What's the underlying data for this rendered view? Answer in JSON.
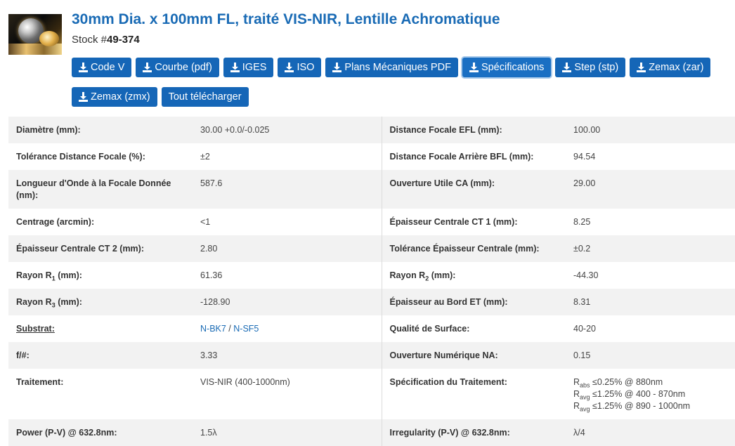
{
  "product": {
    "title": "30mm Dia. x 100mm FL, traité VIS-NIR, Lentille Achromatique",
    "stock_prefix": "Stock #",
    "stock_number": "49-374"
  },
  "icons": {
    "download": "download-icon",
    "thumbnail": "achromatic-lens-image"
  },
  "colors": {
    "primary": "#1566b7",
    "title": "#1a6bb5",
    "row_alt": "#f2f2f2"
  },
  "buttons_row1": [
    "Code V",
    "Courbe (pdf)",
    "IGES",
    "ISO",
    "Plans Mécaniques PDF",
    "Spécifications",
    "Step (stp)",
    "Zemax (zar)"
  ],
  "buttons_row2": [
    "Zemax (zmx)",
    "Tout télécharger"
  ],
  "specs": {
    "diametre": {
      "label": "Diamètre (mm):",
      "value": "30.00 +0.0/-0.025"
    },
    "efl": {
      "label": "Distance Focale EFL (mm):",
      "value": "100.00"
    },
    "tol_focale": {
      "label": "Tolérance Distance Focale (%):",
      "value": "±2"
    },
    "bfl": {
      "label": "Distance Focale Arrière BFL (mm):",
      "value": "94.54"
    },
    "longueur_onde": {
      "label": "Longueur d'Onde à la Focale Donnée (nm):",
      "value": "587.6"
    },
    "ouverture_ca": {
      "label": "Ouverture Utile CA (mm):",
      "value": "29.00"
    },
    "centrage": {
      "label": "Centrage (arcmin):",
      "value": "<1"
    },
    "ct1": {
      "label": "Épaisseur Centrale CT 1 (mm):",
      "value": "8.25"
    },
    "ct2": {
      "label": "Épaisseur Centrale CT 2 (mm):",
      "value": "2.80"
    },
    "tol_ct": {
      "label": "Tolérance Épaisseur Centrale (mm):",
      "value": "±0.2"
    },
    "r1": {
      "label_pre": "Rayon R",
      "label_sub": "1",
      "label_post": " (mm):",
      "value": "61.36"
    },
    "r2": {
      "label_pre": "Rayon R",
      "label_sub": "2",
      "label_post": " (mm):",
      "value": "-44.30"
    },
    "r3": {
      "label_pre": "Rayon R",
      "label_sub": "3",
      "label_post": " (mm):",
      "value": "-128.90"
    },
    "et": {
      "label": "Épaisseur au Bord ET (mm):",
      "value": "8.31"
    },
    "substrat": {
      "label": "Substrat:",
      "value1": "N-BK7",
      "sep": " / ",
      "value2": "N-SF5"
    },
    "qualite": {
      "label": "Qualité de Surface:",
      "value": "40-20"
    },
    "fnum": {
      "label": "f/#:",
      "value": "3.33"
    },
    "na": {
      "label": "Ouverture Numérique NA:",
      "value": "0.15"
    },
    "traitement": {
      "label": "Traitement:",
      "value": "VIS-NIR (400-1000nm)"
    },
    "spec_traitement": {
      "label": "Spécification du Traitement:",
      "lines": [
        {
          "pre": "R",
          "sub": "abs",
          "post": " ≤0.25% @ 880nm"
        },
        {
          "pre": "R",
          "sub": "avg",
          "post": " ≤1.25% @ 400 - 870nm"
        },
        {
          "pre": "R",
          "sub": "avg",
          "post": " ≤1.25% @ 890 - 1000nm"
        }
      ]
    },
    "power": {
      "label": "Power (P-V) @ 632.8nm:",
      "value": "1.5λ"
    },
    "irregularity": {
      "label": "Irregularity (P-V) @ 632.8nm:",
      "value": "λ/4"
    }
  }
}
